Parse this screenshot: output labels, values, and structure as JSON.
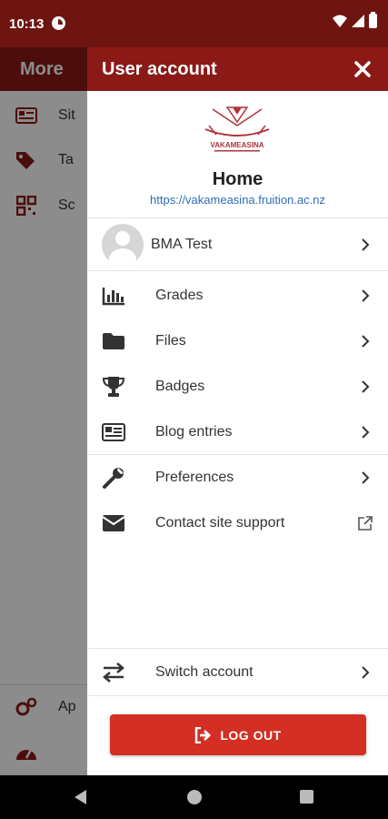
{
  "status_bar": {
    "time": "10:13"
  },
  "background_app": {
    "header_title": "More",
    "items": [
      {
        "label": "Sit",
        "icon": "newspaper-icon"
      },
      {
        "label": "Ta",
        "icon": "tags-icon"
      },
      {
        "label": "Sc",
        "icon": "qrcode-icon"
      },
      {
        "label": "Ap",
        "icon": "gears-icon"
      }
    ]
  },
  "drawer": {
    "title": "User account",
    "site": {
      "logo_text": "VAKAMEASINA",
      "name": "Home",
      "url": "https://vakameasina.fruition.ac.nz"
    },
    "user": {
      "name": "BMA Test"
    },
    "menu": [
      {
        "label": "Grades",
        "icon": "chart-bar-icon"
      },
      {
        "label": "Files",
        "icon": "folder-icon"
      },
      {
        "label": "Badges",
        "icon": "trophy-icon"
      },
      {
        "label": "Blog entries",
        "icon": "newspaper-icon"
      }
    ],
    "settings": [
      {
        "label": "Preferences",
        "icon": "wrench-icon"
      },
      {
        "label": "Contact site support",
        "icon": "envelope-icon",
        "external": true
      }
    ],
    "switch_account": {
      "label": "Switch account",
      "icon": "swap-icon"
    },
    "logout": {
      "label": "LOG OUT",
      "color": "#d32f24"
    }
  },
  "colors": {
    "brand": "#8b1a17",
    "status_bar": "#6e1512",
    "link": "#2e6db8"
  }
}
